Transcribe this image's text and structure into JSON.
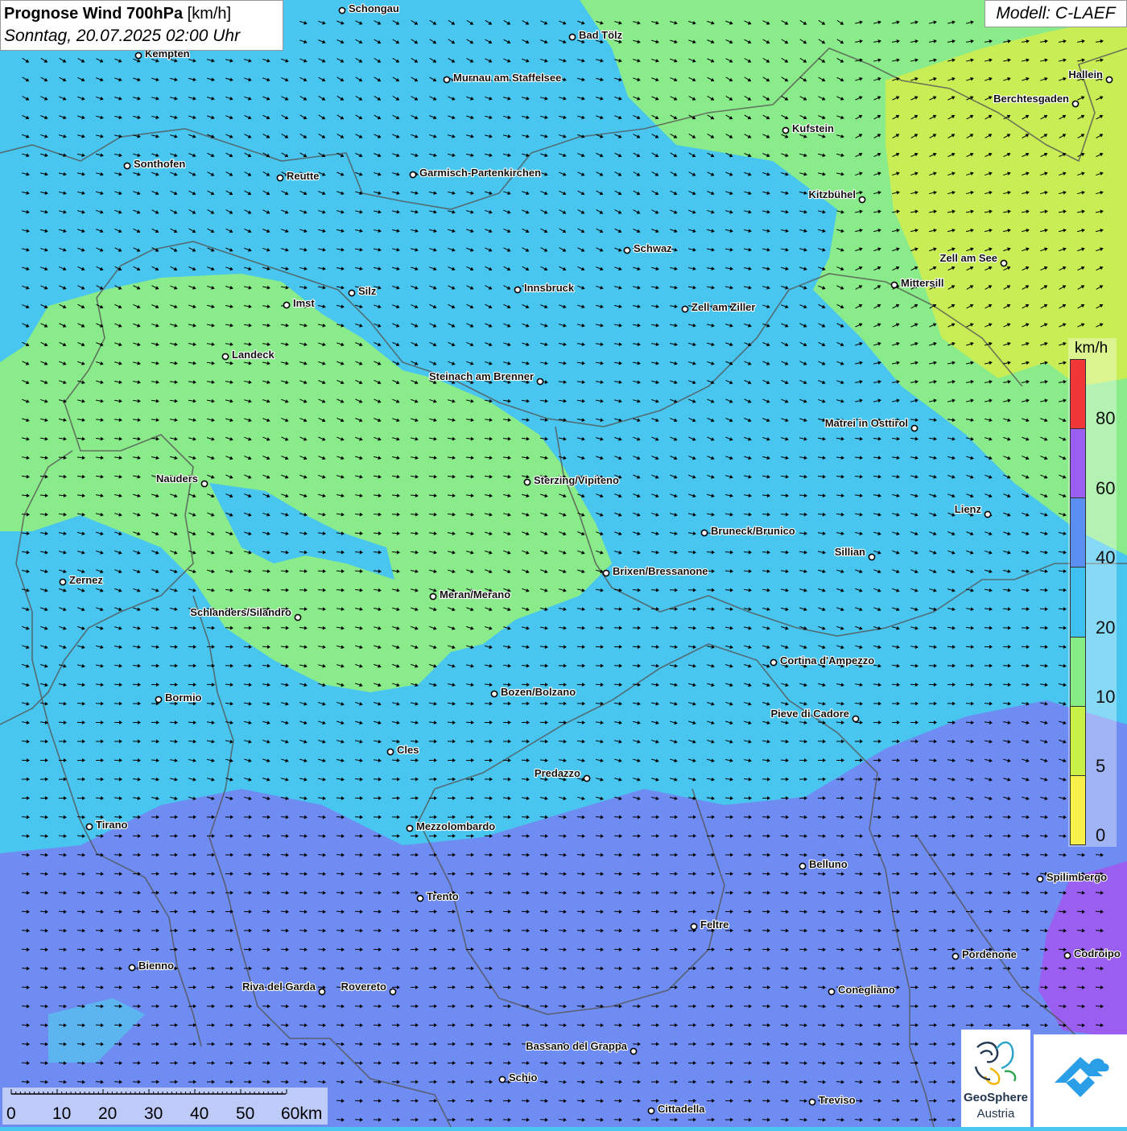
{
  "header": {
    "title_bold": "Prognose Wind 700hPa",
    "title_unit": " [km/h]",
    "subtitle": "Sonntag, 20.07.2025 02:00 Uhr"
  },
  "model_label": "Modell: C-LAEF",
  "legend": {
    "unit": "km/h",
    "ticks": [
      "80",
      "60",
      "40",
      "20",
      "10",
      "5",
      "0"
    ],
    "colors": [
      "#f03636",
      "#9a5ef0",
      "#5a8ef0",
      "#3ec0f0",
      "#86ec86",
      "#c8f046",
      "#f8f04a"
    ]
  },
  "scale_bar": {
    "labels": [
      "0",
      "10",
      "20",
      "30",
      "40",
      "50",
      "60km"
    ]
  },
  "logo": {
    "name": "GeoSphere",
    "country": "Austria"
  },
  "map_colors": {
    "calm_light_green": "#86ec86",
    "yellow_green": "#c8f046",
    "light_blue": "#48c6f0",
    "blue": "#6f8cf2",
    "violet": "#9a5ef0",
    "borders": "#555555",
    "arrows": "#000000"
  },
  "cities": [
    {
      "name": "Schongau"
    },
    {
      "name": "Bad Tölz"
    },
    {
      "name": "Kempten"
    },
    {
      "name": "Murnau am Staffelsee"
    },
    {
      "name": "Hallein"
    },
    {
      "name": "Berchtesgaden"
    },
    {
      "name": "Kufstein"
    },
    {
      "name": "Sonthofen"
    },
    {
      "name": "Reutte"
    },
    {
      "name": "Garmisch-Partenkirchen"
    },
    {
      "name": "Kitzbühel"
    },
    {
      "name": "Schwaz"
    },
    {
      "name": "Zell am See"
    },
    {
      "name": "Mittersill"
    },
    {
      "name": "Innsbruck"
    },
    {
      "name": "Silz"
    },
    {
      "name": "Imst"
    },
    {
      "name": "Zell am Ziller"
    },
    {
      "name": "Landeck"
    },
    {
      "name": "Steinach am Brenner"
    },
    {
      "name": "Matrei in Osttirol"
    },
    {
      "name": "Nauders"
    },
    {
      "name": "Sterzing/Vipiteno"
    },
    {
      "name": "Lienz"
    },
    {
      "name": "Bruneck/Brunico"
    },
    {
      "name": "Sillian"
    },
    {
      "name": "Brixen/Bressanone"
    },
    {
      "name": "Zernez"
    },
    {
      "name": "Meran/Merano"
    },
    {
      "name": "Schlanders/Silandro"
    },
    {
      "name": "Cortina d'Ampezzo"
    },
    {
      "name": "Bozen/Bolzano"
    },
    {
      "name": "Bormio"
    },
    {
      "name": "Pieve di Cadore"
    },
    {
      "name": "Cles"
    },
    {
      "name": "Predazzo"
    },
    {
      "name": "Tirano"
    },
    {
      "name": "Mezzolombardo"
    },
    {
      "name": "Belluno"
    },
    {
      "name": "Spilimbergo"
    },
    {
      "name": "Trento"
    },
    {
      "name": "Feltre"
    },
    {
      "name": "Bienno"
    },
    {
      "name": "Pordenone"
    },
    {
      "name": "Codroipo"
    },
    {
      "name": "Riva del Garda"
    },
    {
      "name": "Rovereto"
    },
    {
      "name": "Conegliano"
    },
    {
      "name": "Bassano del Grappa"
    },
    {
      "name": "Schio"
    },
    {
      "name": "Treviso"
    },
    {
      "name": "Cittadella"
    }
  ]
}
